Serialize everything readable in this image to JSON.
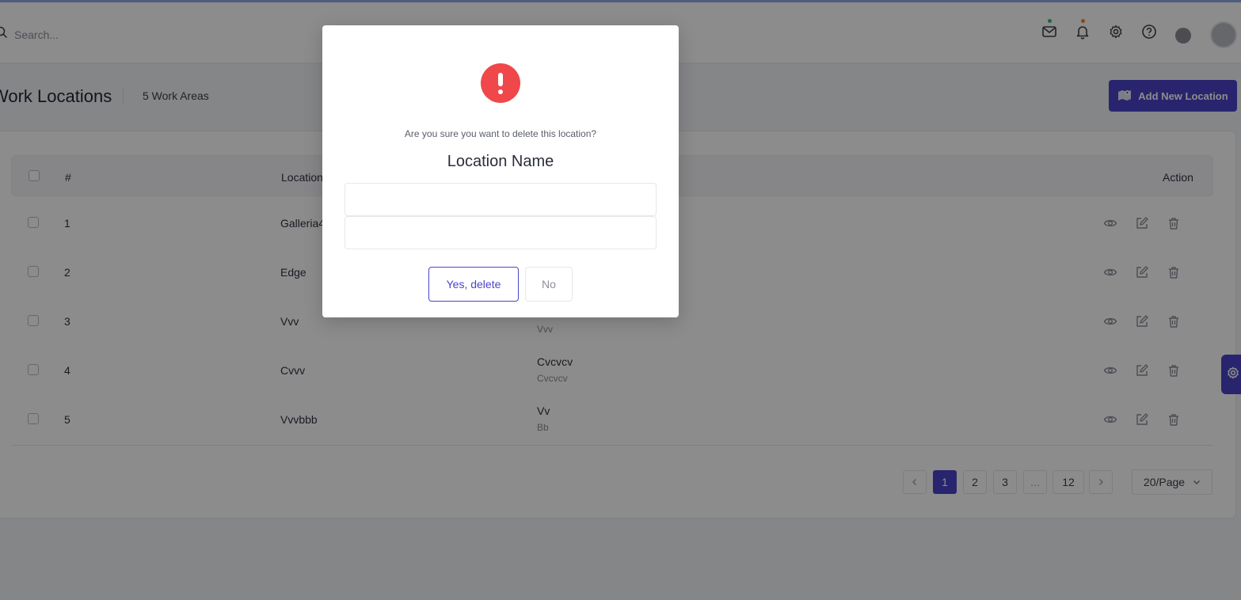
{
  "header": {
    "search_placeholder": "Search...",
    "icons": [
      "mail-icon",
      "bell-icon",
      "gear-icon",
      "help-icon",
      "status-circle",
      "avatar"
    ],
    "mail_dot_color": "#2fbf71",
    "bell_dot_color": "#f08a24"
  },
  "page": {
    "title": "Work Locations",
    "subtitle": "5 Work Areas",
    "add_button_label": "Add New Location"
  },
  "table": {
    "headers": {
      "number": "#",
      "location": "Location",
      "action": "Action"
    },
    "rows": [
      {
        "num": "1",
        "name": "Galleria4",
        "area": "",
        "area_sub": ""
      },
      {
        "num": "2",
        "name": "Edge",
        "area": "",
        "area_sub": ""
      },
      {
        "num": "3",
        "name": "Vvv",
        "area": "",
        "area_sub": "Vvv"
      },
      {
        "num": "4",
        "name": "Cvvv",
        "area": "Cvcvcv",
        "area_sub": "Cvcvcv"
      },
      {
        "num": "5",
        "name": "Vvvbbb",
        "area": "Vv",
        "area_sub": "Bb"
      }
    ],
    "row_actions": [
      "eye-icon",
      "edit-icon",
      "trash-icon"
    ]
  },
  "pagination": {
    "pages": [
      "1",
      "2",
      "3",
      "...",
      "12"
    ],
    "current": "1",
    "per_page": "20/Page"
  },
  "modal": {
    "question": "Are you sure you want to delete this location?",
    "name_label": "Location Name",
    "field1_value": "",
    "field2_value": "",
    "confirm_label": "Yes, delete",
    "cancel_label": "No",
    "warn_color": "#f0474a"
  },
  "colors": {
    "accent": "#4a44c9",
    "danger": "#f0474a"
  }
}
